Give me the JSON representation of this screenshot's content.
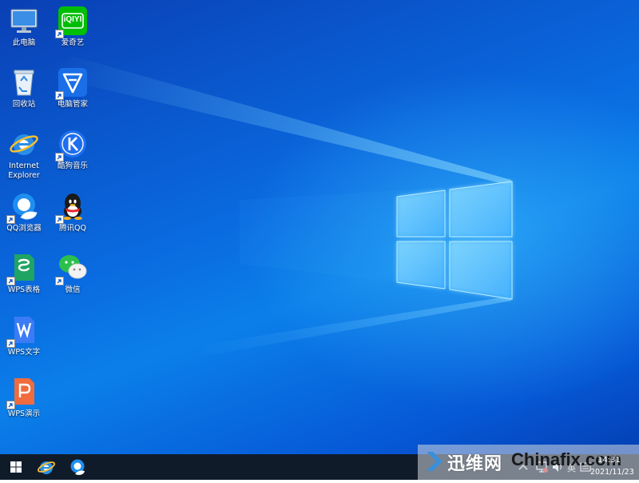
{
  "desktop": {
    "icons": [
      {
        "label": "此电脑",
        "icon": "computer-icon"
      },
      {
        "label": "爱奇艺",
        "icon": "iqiyi-icon"
      },
      {
        "label": "回收站",
        "icon": "recycle-bin-icon"
      },
      {
        "label": "电脑管家",
        "icon": "pc-manager-icon"
      },
      {
        "label": "Internet Explorer",
        "icon": "ie-icon"
      },
      {
        "label": "酷狗音乐",
        "icon": "kugou-icon"
      },
      {
        "label": "QQ浏览器",
        "icon": "qq-browser-icon"
      },
      {
        "label": "腾讯QQ",
        "icon": "qq-icon"
      },
      {
        "label": "WPS表格",
        "icon": "wps-sheet-icon"
      },
      {
        "label": "微信",
        "icon": "wechat-icon"
      },
      {
        "label": "WPS文字",
        "icon": "wps-writer-icon"
      },
      {
        "label": "WPS演示",
        "icon": "wps-presentation-icon"
      }
    ],
    "iqiyi_text": "iQIYI"
  },
  "taskbar": {
    "pinned": [
      "start-icon",
      "ie-icon",
      "qq-browser-icon"
    ],
    "tray": {
      "ime": "英",
      "time": "14:31",
      "date": "2021/11/23"
    }
  },
  "watermark": {
    "cn": "迅维网",
    "en": "Chinafix.com"
  },
  "colors": {
    "desktop": "#0a6be0",
    "taskbar": "#101b2a",
    "iqiyi": "#00be06",
    "pc_manager": "#1a6fe8",
    "kugou": "#1e6ff0",
    "wps_sheet": "#1fa463",
    "wps_writer": "#3b7bf5",
    "wps_presentation": "#f06b3d",
    "wechat": "#2bc04c"
  }
}
